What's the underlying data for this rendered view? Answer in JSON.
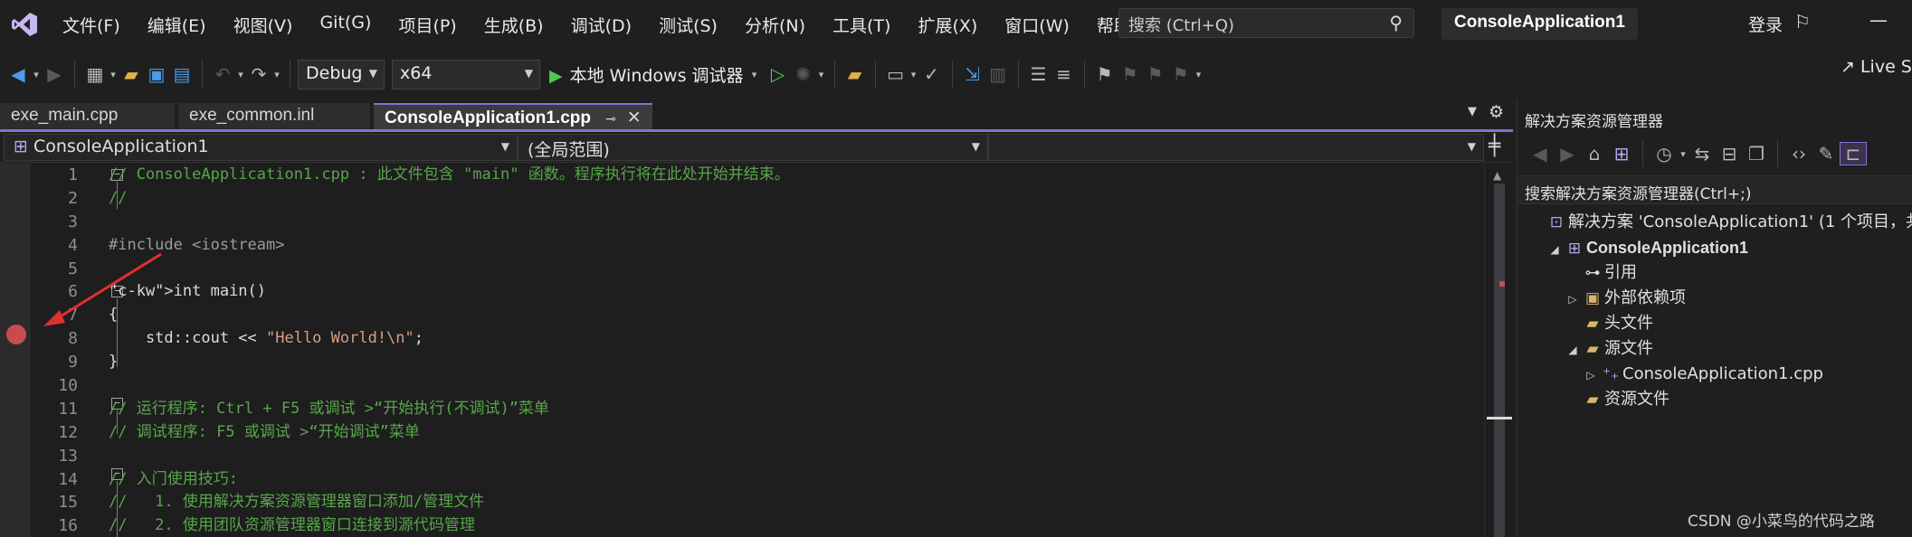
{
  "menu": {
    "items": [
      "文件(F)",
      "编辑(E)",
      "视图(V)",
      "Git(G)",
      "项目(P)",
      "生成(B)",
      "调试(D)",
      "测试(S)",
      "分析(N)",
      "工具(T)",
      "扩展(X)",
      "窗口(W)",
      "帮助(H)"
    ],
    "search_placeholder": "搜索 (Ctrl+Q)",
    "solution_name": "ConsoleApplication1",
    "login": "登录"
  },
  "toolbar": {
    "config": "Debug",
    "platform": "x64",
    "debug_target": "本地 Windows 调试器",
    "live_share": "Live S"
  },
  "tabs": [
    {
      "label": "exe_main.cpp",
      "active": false
    },
    {
      "label": "exe_common.inl",
      "active": false
    },
    {
      "label": "ConsoleApplication1.cpp",
      "active": true
    }
  ],
  "navbar": {
    "project": "ConsoleApplication1",
    "scope": "(全局范围)"
  },
  "editor": {
    "breakpoint_line": 8,
    "lines": [
      {
        "n": "1",
        "text": "// ConsoleApplication1.cpp : 此文件包含 \"main\" 函数。程序执行将在此处开始并结束。"
      },
      {
        "n": "2",
        "text": "//"
      },
      {
        "n": "3",
        "text": ""
      },
      {
        "n": "4",
        "text": "#include <iostream>"
      },
      {
        "n": "5",
        "text": ""
      },
      {
        "n": "6",
        "text": "int main()"
      },
      {
        "n": "7",
        "text": "{"
      },
      {
        "n": "8",
        "text": "    std::cout << \"Hello World!\\n\";"
      },
      {
        "n": "9",
        "text": "}"
      },
      {
        "n": "10",
        "text": ""
      },
      {
        "n": "11",
        "text": "// 运行程序: Ctrl + F5 或调试 >“开始执行(不调试)”菜单"
      },
      {
        "n": "12",
        "text": "// 调试程序: F5 或调试 >“开始调试”菜单"
      },
      {
        "n": "13",
        "text": ""
      },
      {
        "n": "14",
        "text": "// 入门使用技巧:"
      },
      {
        "n": "15",
        "text": "//   1. 使用解决方案资源管理器窗口添加/管理文件"
      },
      {
        "n": "16",
        "text": "//   2. 使用团队资源管理器窗口连接到源代码管理"
      }
    ]
  },
  "solution_explorer": {
    "title": "解决方案资源管理器",
    "search": "搜索解决方案资源管理器(Ctrl+;)",
    "tree": [
      {
        "label": "解决方案 'ConsoleApplication1' (1 个项目，共",
        "indent": 0,
        "expander": "",
        "icon": "solution-icon",
        "bold": false
      },
      {
        "label": "ConsoleApplication1",
        "indent": 1,
        "expander": "◢",
        "icon": "project-icon",
        "bold": true
      },
      {
        "label": "引用",
        "indent": 2,
        "expander": "",
        "icon": "references-icon",
        "bold": false
      },
      {
        "label": "外部依赖项",
        "indent": 2,
        "expander": "▷",
        "icon": "external-deps-icon",
        "bold": false
      },
      {
        "label": "头文件",
        "indent": 2,
        "expander": "",
        "icon": "filter-folder-icon",
        "bold": false
      },
      {
        "label": "源文件",
        "indent": 2,
        "expander": "◢",
        "icon": "filter-folder-icon",
        "bold": false
      },
      {
        "label": "ConsoleApplication1.cpp",
        "indent": 3,
        "expander": "▷",
        "icon": "cpp-file-icon",
        "bold": false
      },
      {
        "label": "资源文件",
        "indent": 2,
        "expander": "",
        "icon": "filter-folder-icon",
        "bold": false
      }
    ]
  },
  "watermark": "CSDN @小菜鸟的代码之路",
  "colors": {
    "accent": "#8a6ed3",
    "breakpoint": "#c84b52",
    "comment": "#57a64a",
    "keyword": "#569cd6",
    "string": "#d69d85"
  }
}
